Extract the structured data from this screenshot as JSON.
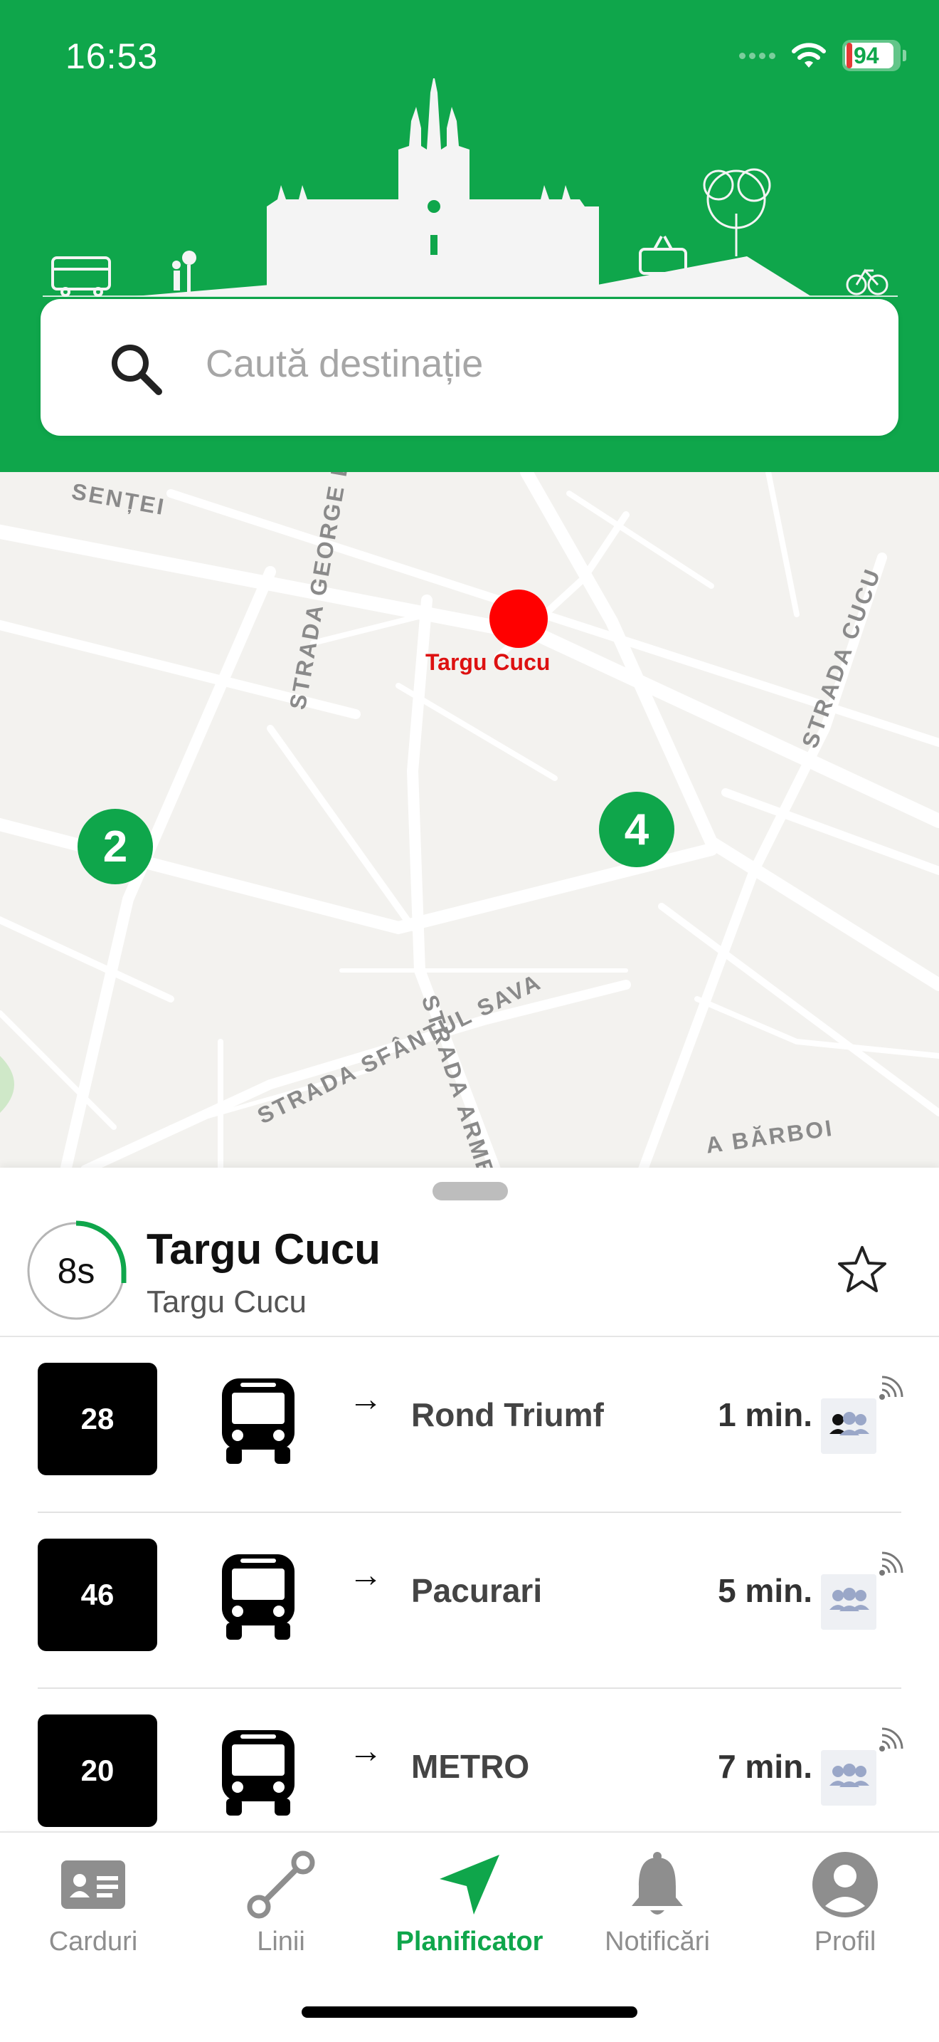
{
  "status_bar": {
    "time": "16:53",
    "battery": "94"
  },
  "search": {
    "placeholder": "Caută destinație"
  },
  "map": {
    "streets": [
      "SENȚEI",
      "STRADA GEORGE ENESCU",
      "STRADA CUCU",
      "STRADA SFÂNTUL SAVA",
      "STRADA ARMEA",
      "A BĂRBOI"
    ],
    "selected_stop": "Targu Cucu",
    "clusters": [
      "2",
      "4"
    ]
  },
  "stop": {
    "countdown": "8s",
    "title": "Targu Cucu",
    "subtitle": "Targu Cucu"
  },
  "arrivals": [
    {
      "line": "28",
      "destination": "Rond Triumf",
      "eta": "1 min."
    },
    {
      "line": "46",
      "destination": "Pacurari",
      "eta": "5 min."
    },
    {
      "line": "20",
      "destination": "METRO",
      "eta": "7 min."
    }
  ],
  "tabs": [
    {
      "label": "Carduri",
      "icon": "id-card-icon"
    },
    {
      "label": "Linii",
      "icon": "route-icon"
    },
    {
      "label": "Planificator",
      "icon": "navigation-arrow-icon"
    },
    {
      "label": "Notificări",
      "icon": "bell-icon"
    },
    {
      "label": "Profil",
      "icon": "profile-icon"
    }
  ],
  "colors": {
    "brand": "#0fa64b",
    "stop_marker": "#ff0000"
  }
}
